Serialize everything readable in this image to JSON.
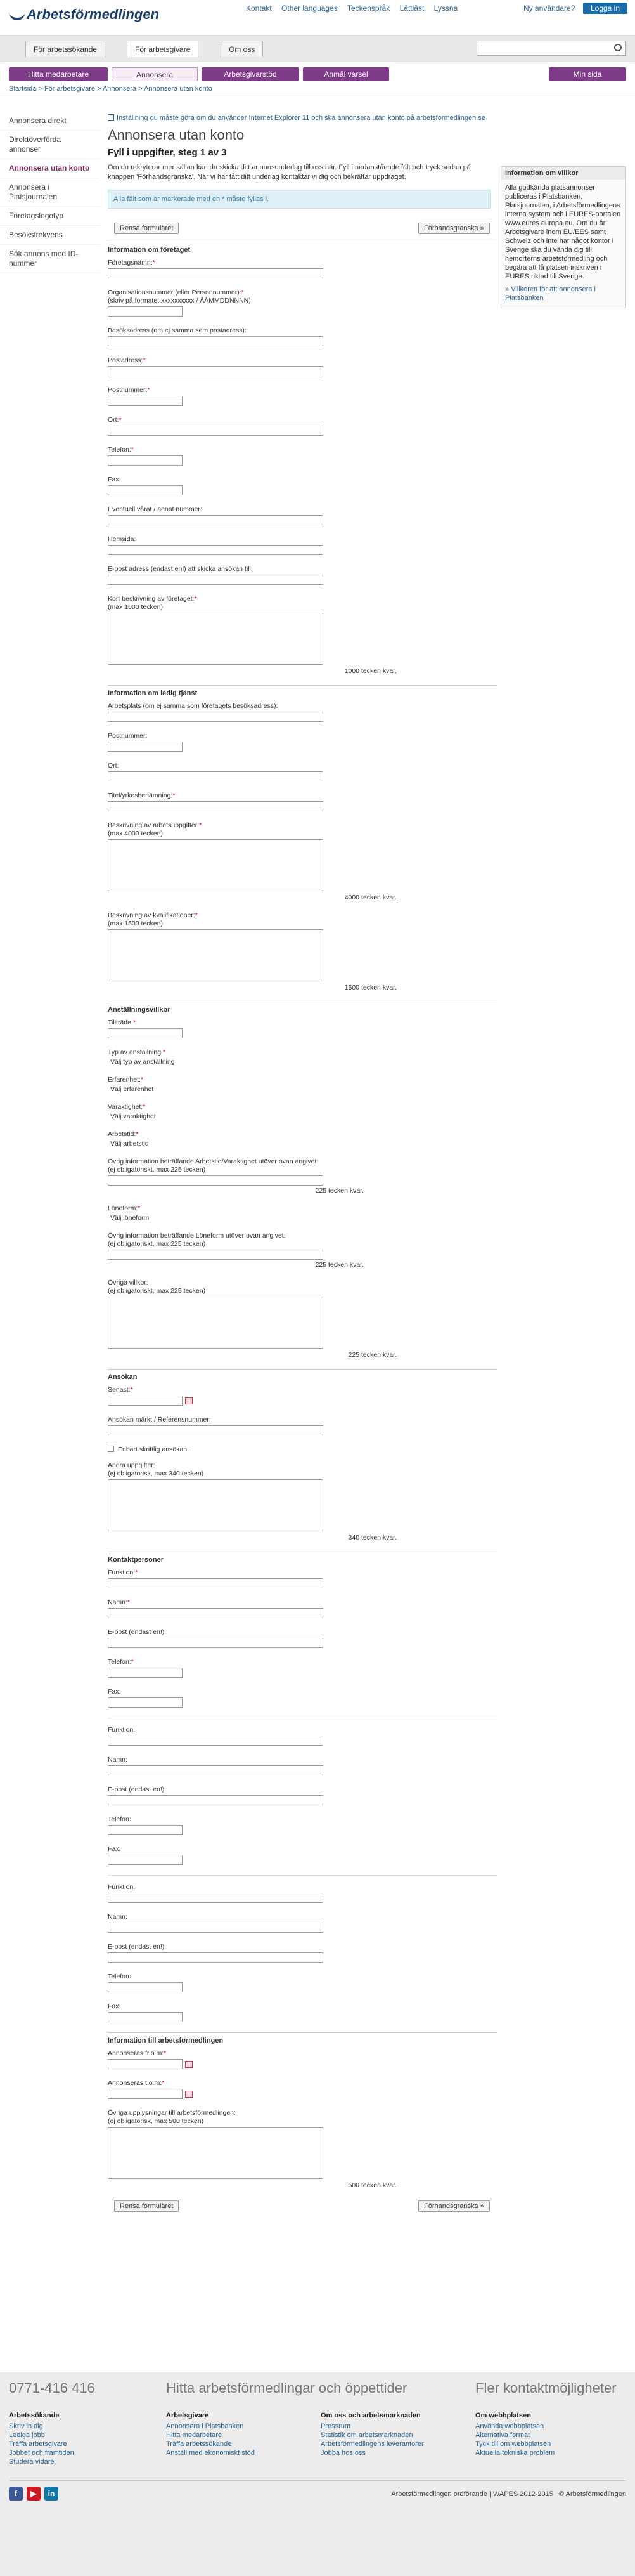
{
  "header": {
    "logo": "Arbetsförmedlingen",
    "links": [
      "Kontakt",
      "Other languages",
      "Teckenspråk",
      "Lättläst",
      "Lyssna"
    ],
    "user": "Ny användare?",
    "login": "Logga in"
  },
  "tabs": [
    "För arbetssökande",
    "För arbetsgivare",
    "Om oss"
  ],
  "search": {
    "placeholder": ""
  },
  "purple": [
    "Hitta medarbetare",
    "Annonsera",
    "Arbetsgivarstöd",
    "Anmäl varsel",
    "Min sida"
  ],
  "breadcrumb": "Startsida > För arbetsgivare > Annonsera > Annonsera utan konto",
  "side": [
    "Annonsera direkt",
    "Direktöverförda annonser",
    "Annonsera utan konto",
    "Annonsera i Platsjournalen",
    "Företagslogotyp",
    "Besöksfrekvens",
    "Sök annons med ID-nummer"
  ],
  "notice": "Inställning du måste göra om du använder Internet Explorer 11 och ska annonsera utan konto på arbetsformedlingen.se",
  "title": "Annonsera utan konto",
  "step": "Fyll i uppgifter, steg 1 av 3",
  "intro": "Om du rekryterar mer sällan kan du skicka ditt annonsunderlag till oss här. Fyll i nedanstående fält och tryck sedan på knappen 'Förhandsgranska'. När vi har fått ditt underlag kontaktar vi dig och bekräftar uppdraget.",
  "info": "Alla fält som är markerade med en * måste fyllas i.",
  "btn": {
    "reset": "Rensa formuläret",
    "preview": "Förhandsgranska »"
  },
  "rightbox": {
    "title": "Information om villkor",
    "text": "Alla godkända platsannonser publiceras i Platsbanken, Platsjournalen, i Arbetsförmedlingens interna system och i EURES-portalen www.eures.europa.eu. Om du är Arbetsgivare inom EU/EES samt Schweiz och inte har något kontor i Sverige ska du vända dig till hemorterns arbetsförmedling och begära att få platsen inskriven i EURES riktad till Sverige.",
    "link": "Villkoren för att annonsera i Platsbanken"
  },
  "company": {
    "head": "Information om företaget",
    "name": "Företagsnamn:",
    "org": "Organisationsnummer (eller Personnummer):",
    "orgfmt": "(skriv på formatet xxxxxxxxxx / ÅÅMMDDNNNN)",
    "visit": "Besöksadress (om ej samma som postadress):",
    "post": "Postadress:",
    "zip": "Postnummer:",
    "city": "Ort:",
    "phone": "Telefon:",
    "fax": "Fax:",
    "ref": "Eventuell vårat / annat nummer:",
    "web": "Hemsida:",
    "email": "E-post adress (endast en!) att skicka ansökan till:",
    "desc": "Kort beskrivning av företaget:",
    "descmax": "(max 1000 tecken)",
    "desccount": "1000 tecken kvar."
  },
  "job": {
    "head": "Information om ledig tjänst",
    "place": "Arbetsplats (om ej samma som företagets besöksadress):",
    "zip": "Postnummer:",
    "city": "Ort:",
    "title": "Titel/yrkesbenämning:",
    "tasks": "Beskrivning av arbetsuppgifter:",
    "tasksmax": "(max 4000 tecken)",
    "taskscount": "4000 tecken kvar.",
    "qual": "Beskrivning av kvalifikationer:",
    "qualmax": "(max 1500 tecken)",
    "qualcount": "1500 tecken kvar."
  },
  "terms": {
    "head": "Anställningsvillkor",
    "access": "Tillträde:",
    "type": "Typ av anställning:",
    "typeval": "Välj typ av anställning",
    "exp": "Erfarenhet:",
    "expval": "Välj erfarenhet",
    "dur": "Varaktighet:",
    "durval": "Välj varaktighet",
    "time": "Arbetstid:",
    "timeval": "Välj arbetstid",
    "other1": "Övrig information beträffande Arbetstid/Varaktighet utöver ovan angivet:",
    "other1sub": "(ej obligatoriskt, max 225 tecken)",
    "other1count": "225 tecken kvar.",
    "wage": "Löneform:",
    "wageval": "Välj löneform",
    "other2": "Övrig information beträffande Löneform utöver ovan angivet:",
    "other2sub": "(ej obligatoriskt, max 225 tecken)",
    "other2count": "225 tecken kvar.",
    "other3": "Övriga villkor:",
    "other3sub": "(ej obligatoriskt, max 225 tecken)",
    "other3count": "225 tecken kvar."
  },
  "apply": {
    "head": "Ansökan",
    "last": "Senast:",
    "mark": "Ansökan märkt / Referensnummer:",
    "only": "Enbart skriftlig ansökan.",
    "other": "Andra uppgifter:",
    "othersub": "(ej obligatorisk, max 340 tecken)",
    "count": "340 tecken kvar."
  },
  "contacts": {
    "head": "Kontaktpersoner",
    "func": "Funktion:",
    "name": "Namn:",
    "email": "E-post (endast en!):",
    "phone": "Telefon:",
    "fax": "Fax:"
  },
  "af": {
    "head": "Information till arbetsförmedlingen",
    "from": "Annonseras fr.o.m:",
    "to": "Annonseras t.o.m:",
    "other": "Övriga upplysningar till arbetsförmedlingen:",
    "othersub": "(ej obligatorisk, max 500 tecken)",
    "count": "500 tecken kvar."
  },
  "footer": {
    "phone": "0771-416 416",
    "find": "Hitta arbetsförmedlingar och öppettider",
    "more": "Fler kontaktmöjligheter",
    "cols": [
      {
        "h": "Arbetssökande",
        "l": [
          "Skriv in dig",
          "Lediga jobb",
          "Träffa arbetsgivare",
          "Jobbet och framtiden",
          "Studera vidare"
        ]
      },
      {
        "h": "Arbetsgivare",
        "l": [
          "Annonsera i Platsbanken",
          "Hitta medarbetare",
          "Träffa arbetssökande",
          "Anställ med ekonomiskt stöd"
        ]
      },
      {
        "h": "Om oss och arbetsmarknaden",
        "l": [
          "Pressrum",
          "Statistik om arbetsmarknaden",
          "Arbetsförmedlingens leverantörer",
          "Jobba hos oss"
        ]
      },
      {
        "h": "Om webbplatsen",
        "l": [
          "Använda webbplatsen",
          "Alternativa format",
          "Tyck till om webbplatsen",
          "Aktuella tekniska problem"
        ]
      }
    ],
    "copy": "Arbetsförmedlingen ordförande | WAPES 2012-2015",
    "copy2": "© Arbetsförmedlingen"
  }
}
